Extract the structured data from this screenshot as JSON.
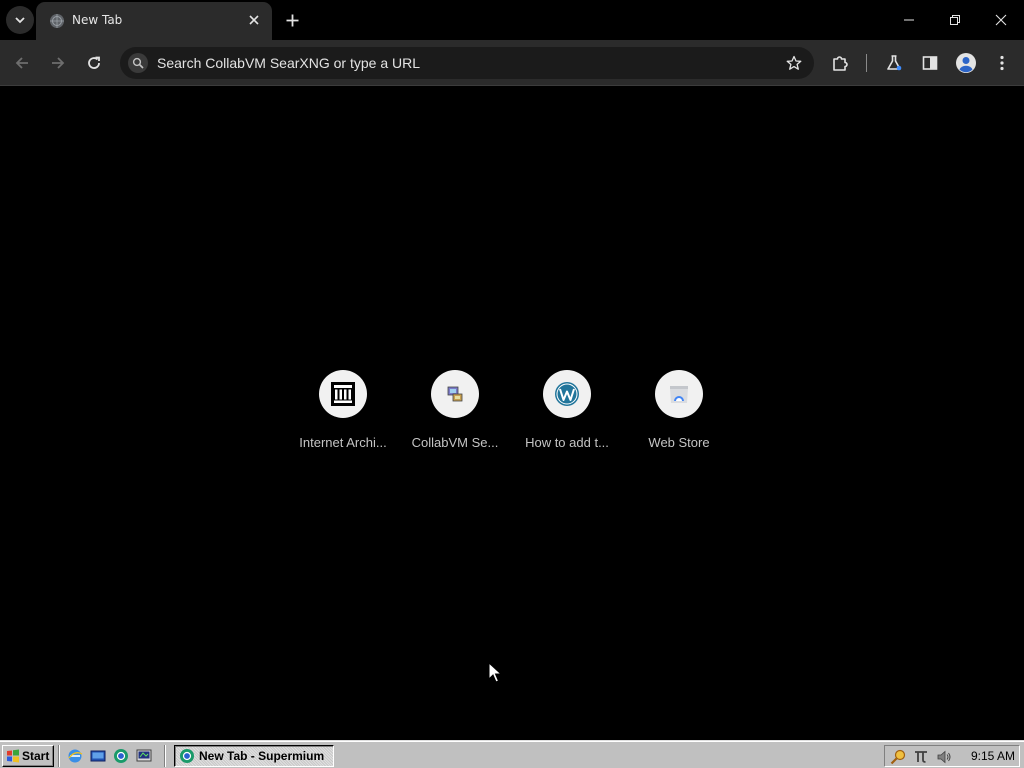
{
  "tab": {
    "title": "New Tab",
    "favicon": "globe-icon"
  },
  "window_controls": {
    "minimize": "minimize-icon",
    "restore": "restore-icon",
    "close": "close-icon"
  },
  "toolbar": {
    "back": "back-arrow-icon",
    "forward": "forward-arrow-icon",
    "reload": "reload-icon",
    "omnibox_placeholder": "Search CollabVM SearXNG or type a URL",
    "bookmark": "star-icon",
    "extensions": "puzzle-icon",
    "labs": "flask-icon",
    "side_panel": "side-panel-icon",
    "profile": "profile-icon",
    "menu": "kebab-menu-icon"
  },
  "shortcuts": [
    {
      "label": "Internet Archi...",
      "icon": "internet-archive-icon"
    },
    {
      "label": "CollabVM Se...",
      "icon": "collabvm-searxng-icon"
    },
    {
      "label": "How to add t...",
      "icon": "wordpress-icon"
    },
    {
      "label": "Web Store",
      "icon": "web-store-icon"
    }
  ],
  "taskbar": {
    "start_label": "Start",
    "quick_launch": [
      "internet-explorer-icon",
      "show-desktop-icon",
      "supermium-icon",
      "channels-icon"
    ],
    "task_button_label": "New Tab - Supermium",
    "tray_icons": [
      "search-tray-icon",
      "network-tray-icon",
      "volume-icon"
    ],
    "clock": "9:15 AM"
  },
  "colors": {
    "chrome_bg": "#000000",
    "toolbar_bg": "#2b2b2b",
    "omnibox_bg": "#1b1b1b",
    "taskbar_bg": "#c0c0c0"
  }
}
